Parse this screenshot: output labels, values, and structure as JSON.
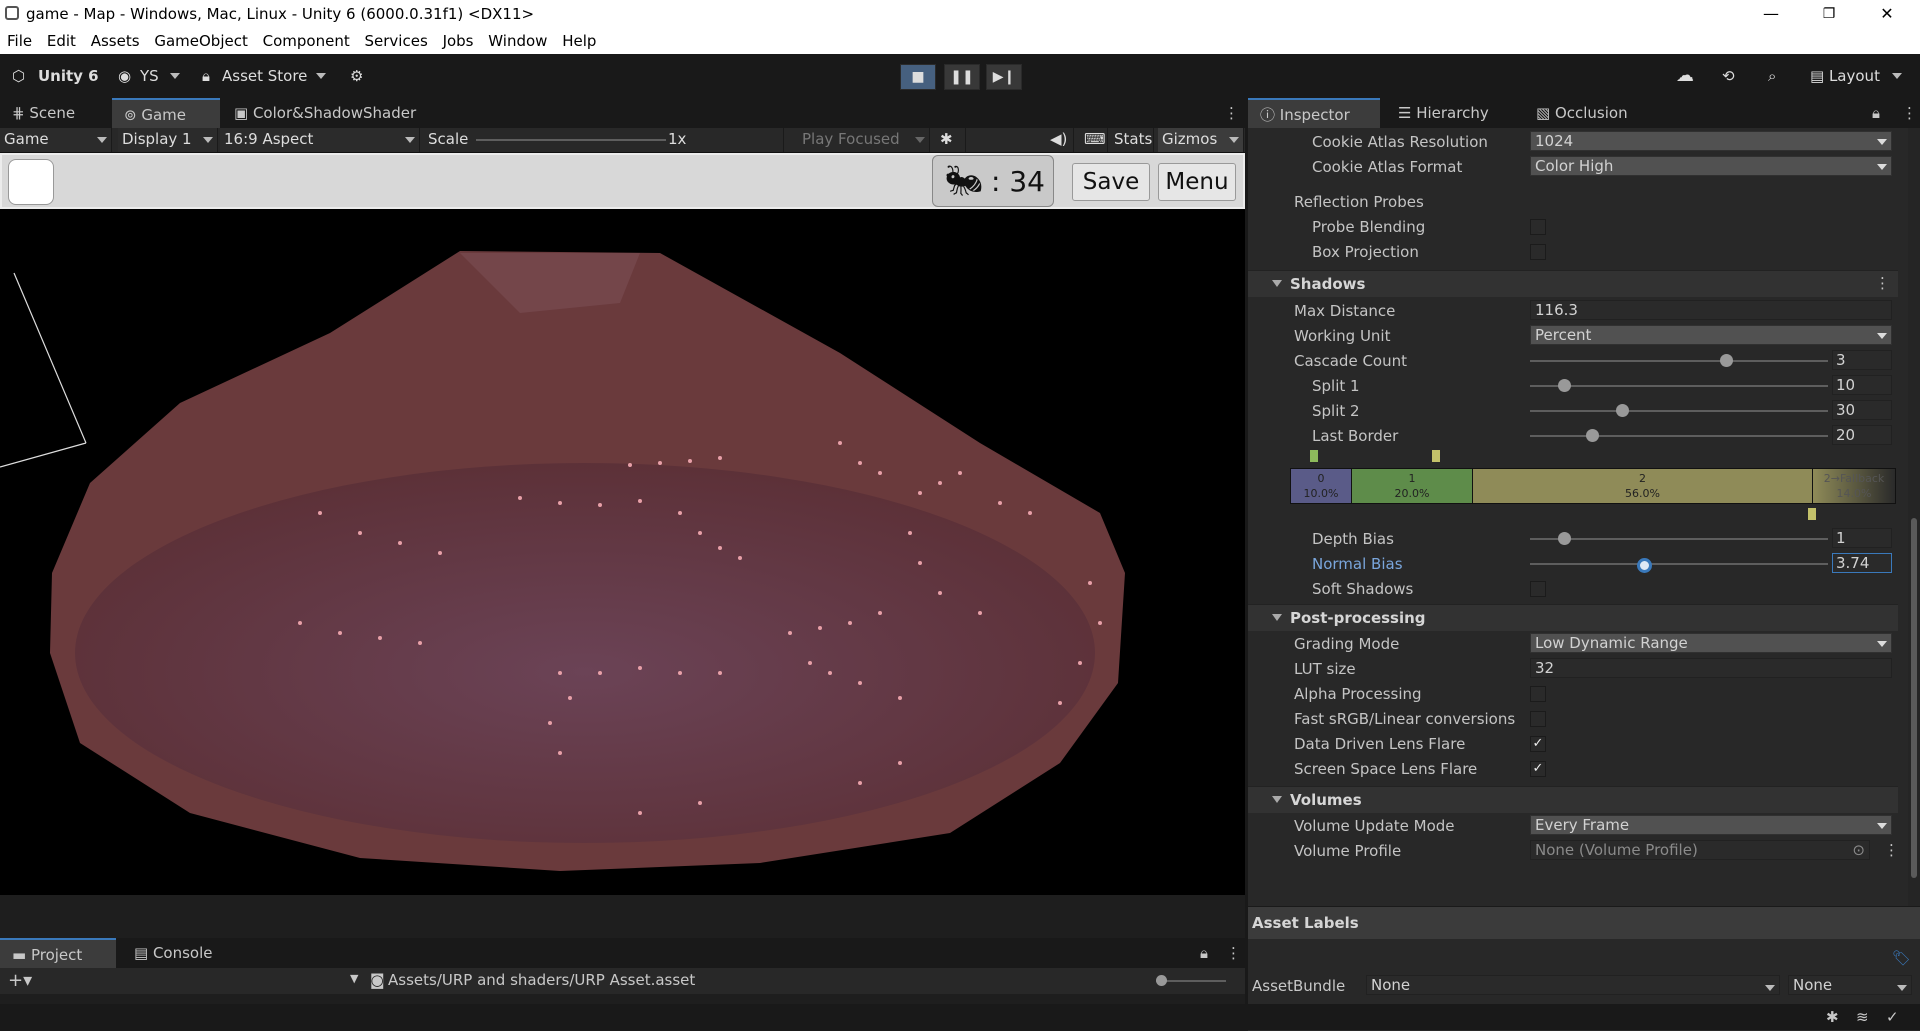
{
  "window": {
    "title": "game - Map - Windows, Mac, Linux - Unity 6 (6000.0.31f1) <DX11>",
    "minimize": "—",
    "maximize": "❐",
    "close": "✕"
  },
  "menu": [
    "File",
    "Edit",
    "Assets",
    "GameObject",
    "Component",
    "Services",
    "Jobs",
    "Window",
    "Help"
  ],
  "toolbar": {
    "unity_label": "Unity 6",
    "account": "YS",
    "asset_store": "Asset Store",
    "layout": "Layout"
  },
  "scene_tabs": [
    "Scene",
    "Game",
    "Color&ShadowShader"
  ],
  "gamebar": {
    "mode": "Game",
    "display": "Display 1",
    "aspect": "16:9 Aspect",
    "scale_label": "Scale",
    "scale_value": "1x",
    "play_focused": "Play Focused",
    "stats": "Stats",
    "gizmos": "Gizmos"
  },
  "game_ui": {
    "ant_count": ": 34",
    "save": "Save",
    "menu": "Menu"
  },
  "inspector_tabs": [
    "Inspector",
    "Hierarchy",
    "Occlusion"
  ],
  "inspector": {
    "cookie_res_label": "Cookie Atlas Resolution",
    "cookie_res_value": "1024",
    "cookie_fmt_label": "Cookie Atlas Format",
    "cookie_fmt_value": "Color High",
    "reflection_label": "Reflection Probes",
    "probe_blending_label": "Probe Blending",
    "box_projection_label": "Box Projection",
    "shadows_title": "Shadows",
    "max_distance_label": "Max Distance",
    "max_distance_value": "116.3",
    "working_unit_label": "Working Unit",
    "working_unit_value": "Percent",
    "cascade_count_label": "Cascade Count",
    "cascade_count_value": "3",
    "split1_label": "Split 1",
    "split1_value": "10",
    "split2_label": "Split 2",
    "split2_value": "30",
    "last_border_label": "Last Border",
    "last_border_value": "20",
    "cascades": [
      {
        "name": "0",
        "pct": "10.0%"
      },
      {
        "name": "1",
        "pct": "20.0%"
      },
      {
        "name": "2",
        "pct": "56.0%"
      },
      {
        "name": "2→Fallback",
        "pct": "14.0%"
      }
    ],
    "depth_bias_label": "Depth Bias",
    "depth_bias_value": "1",
    "normal_bias_label": "Normal Bias",
    "normal_bias_value": "3.74",
    "soft_shadows_label": "Soft Shadows",
    "post_title": "Post-processing",
    "grading_label": "Grading Mode",
    "grading_value": "Low Dynamic Range",
    "lut_label": "LUT size",
    "lut_value": "32",
    "alpha_label": "Alpha Processing",
    "fast_srgb_label": "Fast sRGB/Linear conversions",
    "ddlf_label": "Data Driven Lens Flare",
    "sslf_label": "Screen Space Lens Flare",
    "volumes_title": "Volumes",
    "vol_update_label": "Volume Update Mode",
    "vol_update_value": "Every Frame",
    "vol_profile_label": "Volume Profile",
    "vol_profile_value": "None (Volume Profile)",
    "check": "✓"
  },
  "asset_labels": {
    "title": "Asset Labels",
    "bundle_label": "AssetBundle",
    "bundle_value": "None",
    "variant_value": "None"
  },
  "bottom": {
    "tabs": [
      "Project",
      "Console"
    ],
    "path": "Assets/URP and shaders/URP Asset.asset"
  },
  "colors": {
    "accent": "#3a79bb",
    "bg": "#191919",
    "inspector_bg": "#282828"
  }
}
